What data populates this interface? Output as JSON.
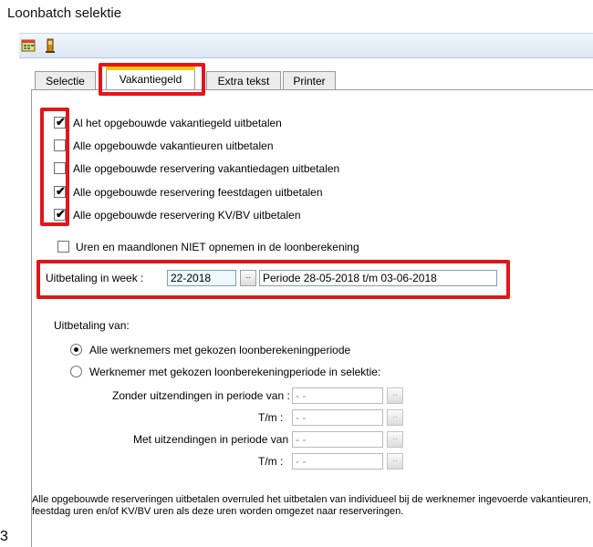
{
  "window": {
    "title": "Loonbatch selektie"
  },
  "toolbar": {
    "icons": [
      "calendar-icon",
      "exit-door-icon"
    ]
  },
  "tabs": [
    {
      "label": "Selectie"
    },
    {
      "label": "Vakantiegeld",
      "active": true
    },
    {
      "label": "Extra tekst"
    },
    {
      "label": "Printer"
    }
  ],
  "options": [
    {
      "label": "Al het opgebouwde vakantiegeld uitbetalen",
      "checked": true
    },
    {
      "label": "Alle opgebouwde vakantieuren uitbetalen",
      "checked": false
    },
    {
      "label": "Alle opgebouwde reservering vakantiedagen uitbetalen",
      "checked": false
    },
    {
      "label": "Alle opgebouwde reservering feestdagen uitbetalen",
      "checked": true
    },
    {
      "label": "Alle opgebouwde reservering KV/BV uitbetalen",
      "checked": true
    }
  ],
  "exclude_option": {
    "label": "Uren en maandlonen NIET opnemen in de loonberekening",
    "checked": false
  },
  "week": {
    "label": "Uitbetaling in week :",
    "value": "22-2018",
    "button": "..",
    "period": "Periode 28-05-2018 t/m 03-06-2018"
  },
  "payout": {
    "heading": "Uitbetaling van:",
    "radio_all": "Alle werknemers met gekozen loonberekeningperiode",
    "radio_selection": "Werknemer met gekozen loonberekeningperiode in selektie:",
    "selected": "radio_all",
    "zonder_label": "Zonder uitzendingen in periode van :",
    "tm1_label": "T/m :",
    "met_label": "Met uitzendingen in periode van :",
    "tm2_label": "T/m :",
    "date_placeholder": " - -",
    "button": ".."
  },
  "note": "Alle opgebouwde reserveringen uitbetalen overruled het uitbetalen van individueel bij de werknemer ingevoerde vakantieuren, feestdag uren en/of KV/BV uren als deze uren worden omgezet naar reserveringen.",
  "corner_text": "3",
  "colors": {
    "highlight_red": "#e3151b",
    "active_tab_yellow": "#f1c900"
  }
}
